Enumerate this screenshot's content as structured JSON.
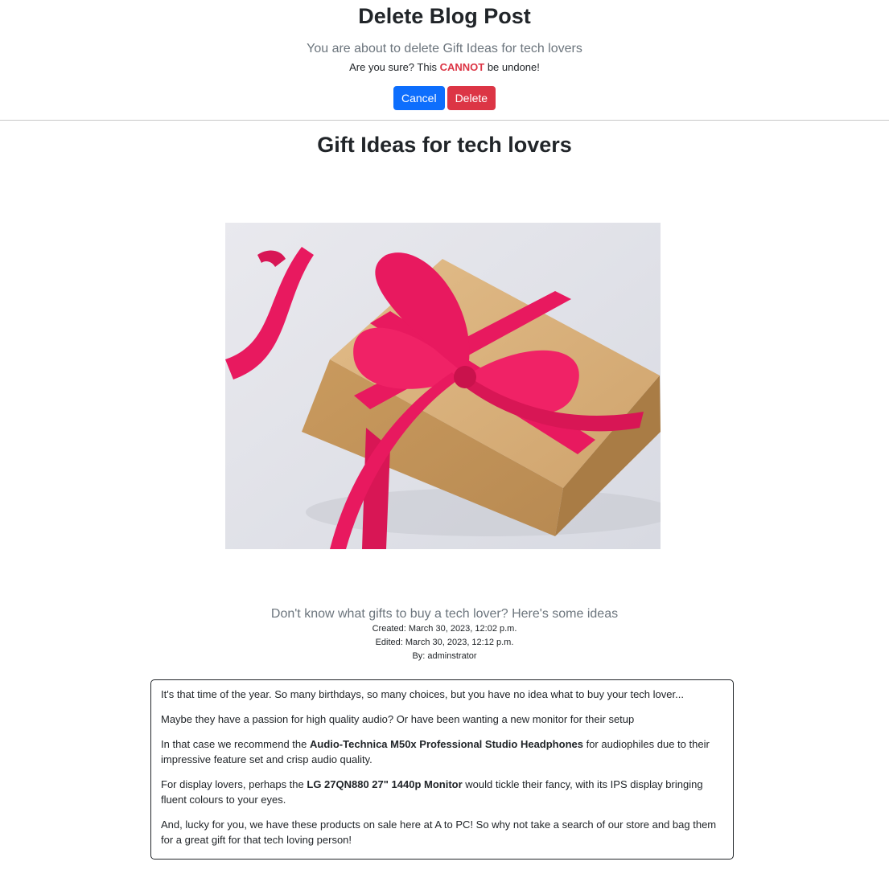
{
  "confirm": {
    "title": "Delete Blog Post",
    "about_text": "You are about to delete Gift Ideas for tech lovers",
    "sure_prefix": "Are you sure? This ",
    "sure_emphasis": "CANNOT",
    "sure_suffix": " be undone!",
    "cancel_label": "Cancel",
    "delete_label": "Delete"
  },
  "post": {
    "title": "Gift Ideas for tech lovers",
    "image_icon": "gift-box-with-pink-ribbon",
    "subtitle": "Don't know what gifts to buy a tech lover? Here's some ideas",
    "created": "Created: March 30, 2023, 12:02 p.m.",
    "edited": "Edited: March 30, 2023, 12:12 p.m.",
    "author": "By: adminstrator",
    "paragraphs": [
      {
        "text": "It's that time of the year. So many birthdays, so many choices, but you have no idea what to buy your tech lover..."
      },
      {
        "text": "Maybe they have a passion for high quality audio? Or have been wanting a new monitor for their setup"
      },
      {
        "before": "In that case we recommend the ",
        "bold": "Audio-Technica M50x Professional Studio Headphones",
        "after": " for audiophiles due to their impressive feature set and crisp audio quality."
      },
      {
        "before": "For display lovers, perhaps the ",
        "bold": "LG 27QN880 27\" 1440p Monitor",
        "after": " would tickle their fancy, with its IPS display bringing fluent colours to your eyes."
      },
      {
        "text": "And, lucky for you, we have these products on sale here at A to PC! So why not take a search of our store and bag them for a great gift for that tech loving person!"
      }
    ]
  },
  "colors": {
    "primary": "#0d6efd",
    "danger": "#dc3545",
    "muted": "#6c757d",
    "ribbon": "#e8195f",
    "kraft": "#d9b07a"
  }
}
